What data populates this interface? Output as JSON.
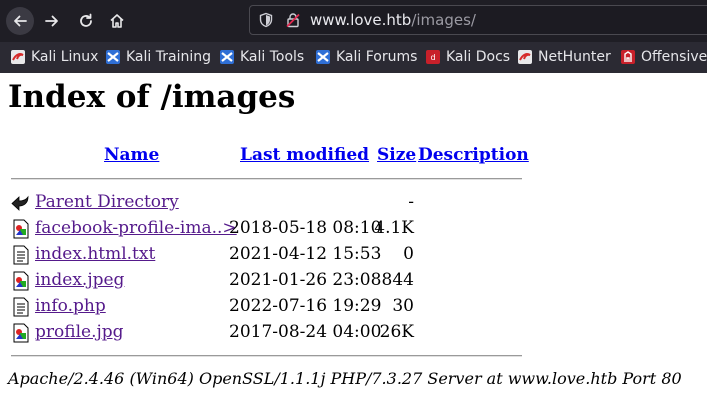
{
  "browser": {
    "url_host": "www.love.htb",
    "url_path": "/images/"
  },
  "bookmarks": [
    {
      "label": "Kali Linux",
      "icon": "kali-linux-icon"
    },
    {
      "label": "Kali Training",
      "icon": "kali-training-icon"
    },
    {
      "label": "Kali Tools",
      "icon": "kali-tools-icon"
    },
    {
      "label": "Kali Forums",
      "icon": "kali-forums-icon"
    },
    {
      "label": "Kali Docs",
      "icon": "kali-docs-icon"
    },
    {
      "label": "NetHunter",
      "icon": "nethunter-icon"
    },
    {
      "label": "Offensive",
      "icon": "offensive-security-icon"
    }
  ],
  "page": {
    "title": "Index of /images",
    "columns": {
      "name": "Name",
      "last_modified": "Last modified",
      "size": "Size",
      "description": "Description"
    },
    "parent": {
      "name": "Parent Directory",
      "size": "-",
      "icon": "back-arrow-icon"
    },
    "files": [
      {
        "name": "facebook-profile-ima..>",
        "modified": "2018-05-18 08:10",
        "size": "4.1K",
        "icon": "image-file-icon"
      },
      {
        "name": "index.html.txt",
        "modified": "2021-04-12 15:53",
        "size": "0",
        "icon": "text-file-icon"
      },
      {
        "name": "index.jpeg",
        "modified": "2021-01-26 23:08",
        "size": "844",
        "icon": "image-file-icon"
      },
      {
        "name": "info.php",
        "modified": "2022-07-16 19:29",
        "size": "30",
        "icon": "text-file-icon"
      },
      {
        "name": "profile.jpg",
        "modified": "2017-08-24 04:00",
        "size": "26K",
        "icon": "image-file-icon"
      }
    ],
    "footer": "Apache/2.4.46 (Win64) OpenSSL/1.1.1j PHP/7.3.27 Server at www.love.htb Port 80"
  }
}
